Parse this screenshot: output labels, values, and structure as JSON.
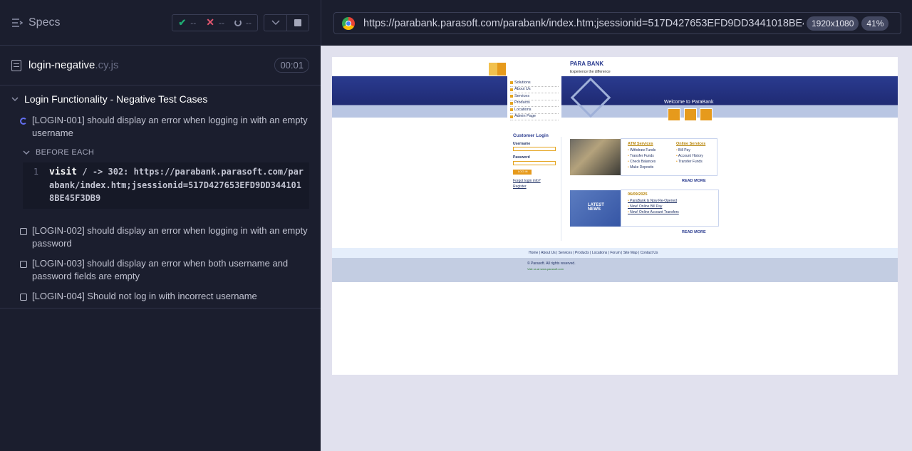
{
  "left": {
    "header": {
      "title": "Specs",
      "passed": "--",
      "failed": "--",
      "pending": "--"
    },
    "file": {
      "name": "login-negative",
      "ext": ".cy.js",
      "duration": "00:01"
    },
    "suite": {
      "title": "Login Functionality - Negative Test Cases"
    },
    "tests": [
      {
        "label": "[LOGIN-001] should display an error when logging in with an empty username",
        "state": "running"
      },
      {
        "label": "[LOGIN-002] should display an error when logging in with an empty password",
        "state": "pending"
      },
      {
        "label": "[LOGIN-003] should display an error when both username and password fields are empty",
        "state": "pending"
      },
      {
        "label": "[LOGIN-004] Should not log in with incorrect username",
        "state": "pending"
      }
    ],
    "hook": {
      "title": "BEFORE EACH",
      "command": {
        "number": "1",
        "name": "visit",
        "message": " / -> 302: https://parabank.parasoft.com/parabank/index.htm;jsessionid=517D427653EFD9DD3441018BE45F3DB9"
      }
    }
  },
  "right": {
    "url": "https://parabank.parasoft.com/parabank/index.htm;jsessionid=517D427653EFD9DD3441018BE45F3DB9",
    "viewport": "1920x1080",
    "zoom": "41%",
    "parabank": {
      "logo": "PARA BANK",
      "tagline": "Experience the difference",
      "menu": [
        "Solutions",
        "About Us",
        "Services",
        "Products",
        "Locations",
        "Admin Page"
      ],
      "welcome": "Welcome to ParaBank",
      "login_title": "Customer Login",
      "username_label": "Username",
      "password_label": "Password",
      "login_button": "LOG IN",
      "forgot": "Forgot login info?",
      "register": "Register",
      "atm_title": "ATM Services",
      "atm_items": [
        "Withdraw Funds",
        "Transfer Funds",
        "Check Balances",
        "Make Deposits"
      ],
      "online_title": "Online Services",
      "online_items": [
        "Bill Pay",
        "Account History",
        "Transfer Funds"
      ],
      "read_more": "READ MORE",
      "news_label": "LATEST NEWS",
      "news_date": "06/09/2025",
      "news_items": [
        "ParaBank Is Now Re-Opened",
        "New! Online Bill Pay",
        "New! Online Account Transfers"
      ],
      "footer_links": "Home | About Us | Services | Products | Locations | Forum | Site Map | Contact Us",
      "copyright": "© Parasoft. All rights reserved.",
      "visit": "Visit us at www.parasoft.com"
    }
  }
}
